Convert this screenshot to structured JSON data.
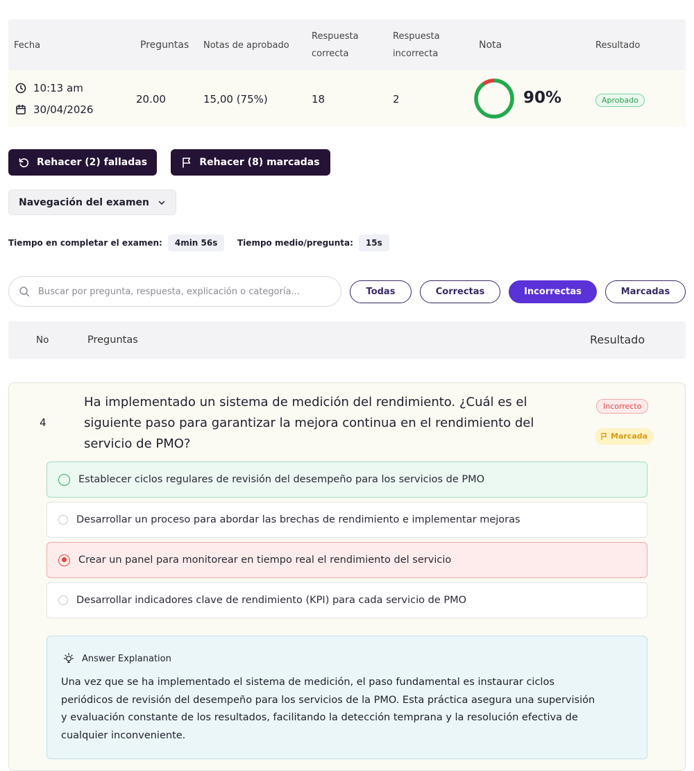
{
  "summary": {
    "headers": {
      "fecha": "Fecha",
      "preguntas": "Preguntas",
      "notas_aprobado": "Notas de aprobado",
      "resp_correcta_1": "Respuesta",
      "resp_correcta_2": "correcta",
      "resp_incorrecta_1": "Respuesta",
      "resp_incorrecta_2": "incorrecta",
      "nota": "Nota",
      "resultado": "Resultado"
    },
    "row": {
      "time": "10:13 am",
      "date": "30/04/2026",
      "preguntas": "20.00",
      "notas_aprobado": "15,00 (75%)",
      "correctas": "18",
      "incorrectas": "2",
      "nota": "90%",
      "nota_value": 0.9,
      "resultado": "Aprobado"
    }
  },
  "actions": {
    "redo_failed": "Rehacer (2) falladas",
    "redo_marked": "Rehacer (8) marcadas",
    "exam_nav": "Navegación del examen"
  },
  "timing": {
    "total_label": "Tiempo en completar el examen:",
    "total_value": "4min 56s",
    "avg_label": "Tiempo medio/pregunta:",
    "avg_value": "15s"
  },
  "search": {
    "placeholder": "Buscar por pregunta, respuesta, explicación o categoría..."
  },
  "filters": [
    "Todas",
    "Correctas",
    "Incorrectas",
    "Marcadas"
  ],
  "active_filter": "Incorrectas",
  "list_header": {
    "no": "No",
    "preguntas": "Preguntas",
    "resultado": "Resultado"
  },
  "question": {
    "number": "4",
    "text_lines": [
      "Ha implementado un sistema de medición del rendimiento. ¿Cuál es el",
      "siguiente paso para garantizar la mejora continua en el rendimiento del",
      "servicio de PMO?"
    ],
    "result_badge": "Incorrecto",
    "flag_badge": "Marcada",
    "options": [
      {
        "text": "Establecer ciclos regulares de revisión del desempeño para los servicios de PMO",
        "state": "correct"
      },
      {
        "text": "Desarrollar un proceso para abordar las brechas de rendimiento e implementar mejoras",
        "state": "neutral"
      },
      {
        "text": "Crear un panel para monitorear en tiempo real el rendimiento del servicio",
        "state": "selected-wrong"
      },
      {
        "text": "Desarrollar indicadores clave de rendimiento (KPI) para cada servicio de PMO",
        "state": "neutral"
      }
    ],
    "explanation_title": "Answer Explanation",
    "explanation_lines": [
      "Una vez que se ha implementado el sistema de medición, el paso fundamental es instaurar ciclos",
      "periódicos de revisión del desempeño para los servicios de la PMO. Esta práctica asegura una supervisión",
      "y evaluación constante de los resultados, facilitando la detección temprana y la resolución efectiva de",
      "cualquier inconveniente."
    ]
  },
  "colors": {
    "primary_dark": "#241334",
    "accent": "#5b31d8",
    "correct": "#2fae66",
    "wrong": "#e2453c",
    "gauge_green": "#22a94d",
    "gauge_red": "#e23b3b"
  }
}
